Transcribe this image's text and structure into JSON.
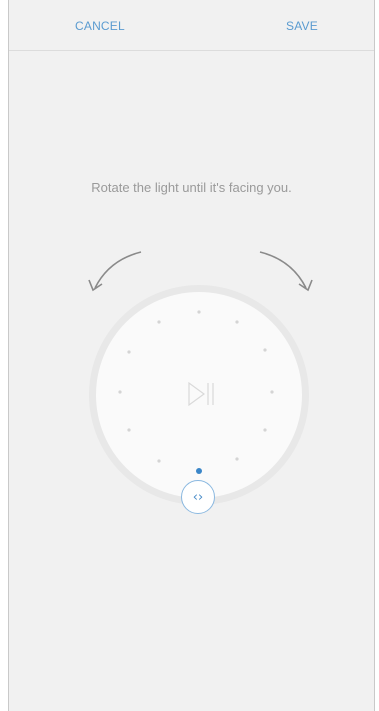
{
  "header": {
    "cancel_label": "CANCEL",
    "save_label": "SAVE"
  },
  "main": {
    "instruction": "Rotate the light until it's facing you."
  },
  "dial": {
    "handle_glyph": "‹›",
    "accent_color": "#3a86c8",
    "ring_color": "#e6e6e6",
    "face_color": "#fafafa",
    "arrow_color": "#8a8a8a"
  }
}
